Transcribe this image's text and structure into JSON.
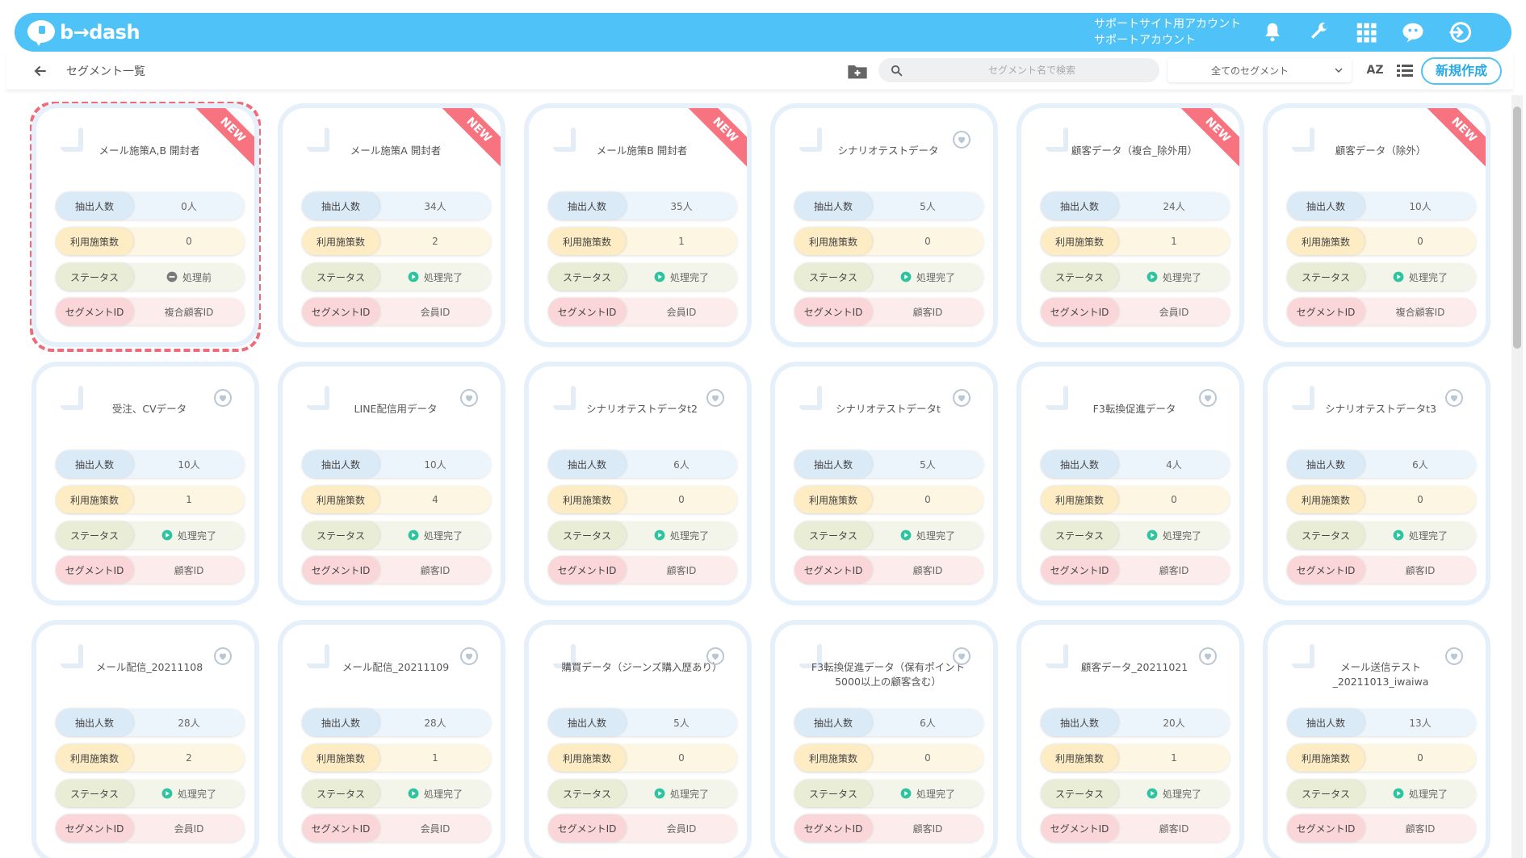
{
  "app": {
    "logo_text": "b→dash",
    "account_line1": "サポートサイト用アカウント",
    "account_line2": "サポートアカウント",
    "brand_color": "#4fc3f7"
  },
  "header_icons": [
    "bell-icon",
    "wrench-icon",
    "apps-grid-icon",
    "support-character-icon",
    "logout-icon"
  ],
  "subbar": {
    "title": "セグメント一覧",
    "search_placeholder": "セグメント名で検索",
    "filter_selected": "全てのセグメント",
    "sort_label": "AZ",
    "new_button": "新規作成"
  },
  "labels": {
    "count": "抽出人数",
    "measures": "利用施策数",
    "status": "ステータス",
    "segment_id": "セグメントID",
    "new_ribbon": "NEW"
  },
  "segments": [
    {
      "name": "メール施策A,B 開封者",
      "count": "0人",
      "measures": "0",
      "status": "処理前",
      "status_type": "pending",
      "id_type": "複合顧客ID",
      "new": true,
      "selected": true
    },
    {
      "name": "メール施策A 開封者",
      "count": "34人",
      "measures": "2",
      "status": "処理完了",
      "status_type": "done",
      "id_type": "会員ID",
      "new": true,
      "selected": false
    },
    {
      "name": "メール施策B 開封者",
      "count": "35人",
      "measures": "1",
      "status": "処理完了",
      "status_type": "done",
      "id_type": "会員ID",
      "new": true,
      "selected": false
    },
    {
      "name": "シナリオテストデータ",
      "count": "5人",
      "measures": "0",
      "status": "処理完了",
      "status_type": "done",
      "id_type": "顧客ID",
      "new": false,
      "selected": false
    },
    {
      "name": "顧客データ（複合_除外用）",
      "count": "24人",
      "measures": "1",
      "status": "処理完了",
      "status_type": "done",
      "id_type": "会員ID",
      "new": true,
      "selected": false
    },
    {
      "name": "顧客データ（除外）",
      "count": "10人",
      "measures": "0",
      "status": "処理完了",
      "status_type": "done",
      "id_type": "複合顧客ID",
      "new": true,
      "selected": false
    },
    {
      "name": "受注、CVデータ",
      "count": "10人",
      "measures": "1",
      "status": "処理完了",
      "status_type": "done",
      "id_type": "顧客ID",
      "new": false,
      "selected": false
    },
    {
      "name": "LINE配信用データ",
      "count": "10人",
      "measures": "4",
      "status": "処理完了",
      "status_type": "done",
      "id_type": "顧客ID",
      "new": false,
      "selected": false
    },
    {
      "name": "シナリオテストデータt2",
      "count": "6人",
      "measures": "0",
      "status": "処理完了",
      "status_type": "done",
      "id_type": "顧客ID",
      "new": false,
      "selected": false
    },
    {
      "name": "シナリオテストデータt",
      "count": "5人",
      "measures": "0",
      "status": "処理完了",
      "status_type": "done",
      "id_type": "顧客ID",
      "new": false,
      "selected": false
    },
    {
      "name": "F3転換促進データ",
      "count": "4人",
      "measures": "0",
      "status": "処理完了",
      "status_type": "done",
      "id_type": "顧客ID",
      "new": false,
      "selected": false
    },
    {
      "name": "シナリオテストデータt3",
      "count": "6人",
      "measures": "0",
      "status": "処理完了",
      "status_type": "done",
      "id_type": "顧客ID",
      "new": false,
      "selected": false
    },
    {
      "name": "メール配信_20211108",
      "count": "28人",
      "measures": "2",
      "status": "処理完了",
      "status_type": "done",
      "id_type": "会員ID",
      "new": false,
      "selected": false
    },
    {
      "name": "メール配信_20211109",
      "count": "28人",
      "measures": "1",
      "status": "処理完了",
      "status_type": "done",
      "id_type": "会員ID",
      "new": false,
      "selected": false
    },
    {
      "name": "購買データ（ジーンズ購入歴あり）",
      "count": "5人",
      "measures": "0",
      "status": "処理完了",
      "status_type": "done",
      "id_type": "会員ID",
      "new": false,
      "selected": false
    },
    {
      "name": "F3転換促進データ（保有ポイント5000以上の顧客含む）",
      "count": "6人",
      "measures": "0",
      "status": "処理完了",
      "status_type": "done",
      "id_type": "顧客ID",
      "new": false,
      "selected": false
    },
    {
      "name": "顧客データ_20211021",
      "count": "20人",
      "measures": "1",
      "status": "処理完了",
      "status_type": "done",
      "id_type": "顧客ID",
      "new": false,
      "selected": false
    },
    {
      "name": "メール送信テスト_20211013_iwaiwa",
      "count": "13人",
      "measures": "0",
      "status": "処理完了",
      "status_type": "done",
      "id_type": "顧客ID",
      "new": false,
      "selected": false
    }
  ]
}
